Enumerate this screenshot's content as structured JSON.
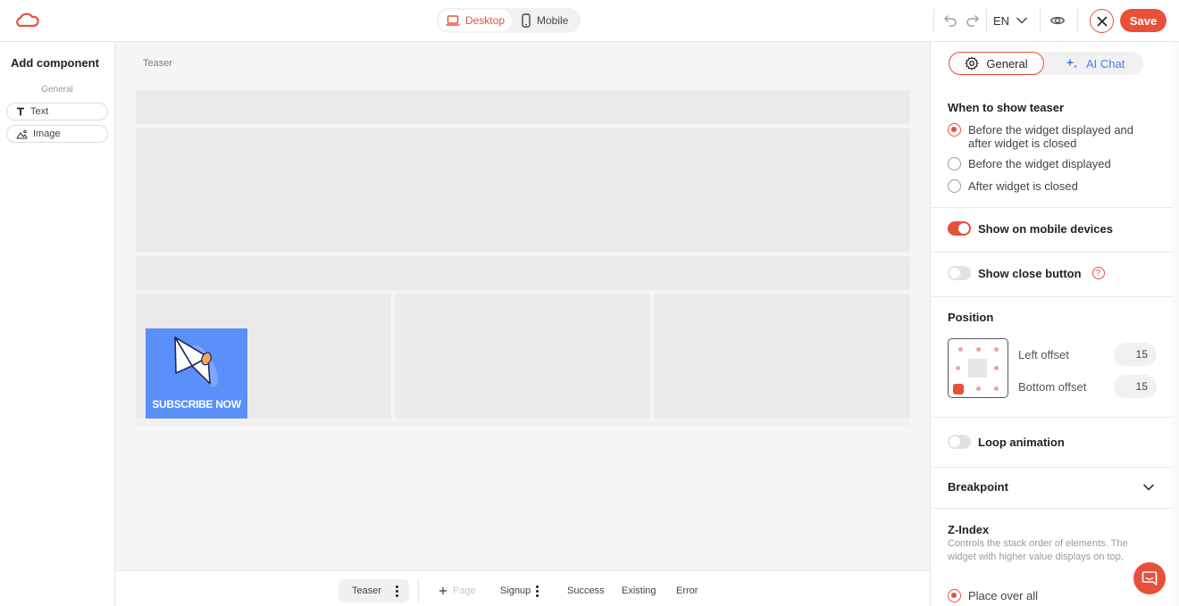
{
  "topbar": {
    "device_desktop": "Desktop",
    "device_mobile": "Mobile",
    "language": "EN",
    "save_label": "Save"
  },
  "left_panel": {
    "title": "Add component",
    "section": "General",
    "components": [
      {
        "label": "Text",
        "icon": "text-icon"
      },
      {
        "label": "Image",
        "icon": "image-icon"
      }
    ]
  },
  "canvas": {
    "breadcrumb": "Teaser",
    "image_text": "SUBSCRIBE NOW"
  },
  "bottom_bar": {
    "active_tab": "Teaser",
    "add_page": "Page",
    "tabs": [
      "Signup",
      "Success",
      "Existing",
      "Error"
    ]
  },
  "right_panel": {
    "tab_general": "General",
    "tab_ai": "AI Chat",
    "when_title": "When to show teaser",
    "when_options": [
      {
        "label": "Before the widget displayed and after widget is closed",
        "selected": true
      },
      {
        "label": "Before the widget displayed",
        "selected": false
      },
      {
        "label": "After widget is closed",
        "selected": false
      }
    ],
    "show_mobile": {
      "label": "Show on mobile devices",
      "on": true
    },
    "show_close": {
      "label": "Show close button",
      "on": false,
      "help": "?"
    },
    "position": {
      "title": "Position",
      "left_offset_label": "Left offset",
      "left_offset_value": "15",
      "bottom_offset_label": "Bottom offset",
      "bottom_offset_value": "15",
      "selected_anchor": "bottom-left"
    },
    "loop_animation": {
      "label": "Loop animation",
      "on": false
    },
    "breakpoint": {
      "label": "Breakpoint"
    },
    "zindex": {
      "title": "Z-Index",
      "description": "Controls the stack order of elements. The widget with higher value displays on top.",
      "option": "Place over all"
    }
  },
  "colors": {
    "accent": "#e8503a",
    "ai_blue": "#4a7cf0",
    "image_bg": "#5b8ff9"
  }
}
